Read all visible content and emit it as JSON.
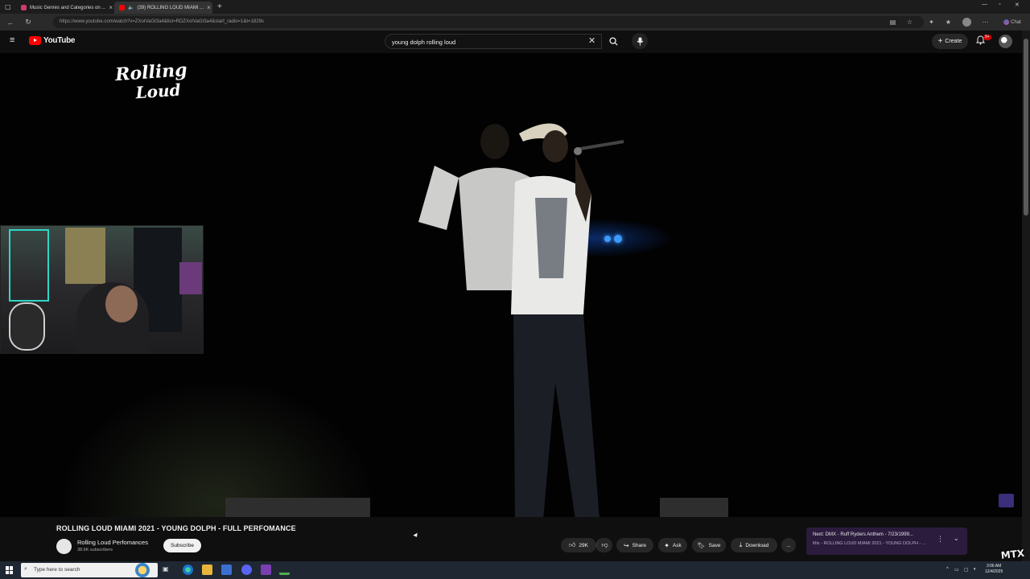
{
  "browser": {
    "tabs": [
      {
        "title": "Music Genres and Categories on ...",
        "active": false
      },
      {
        "title": "(39) ROLLING LOUD MIAMI ...",
        "active": true
      }
    ],
    "new_tab_label": "+",
    "url": "https://www.youtube.com/watch?v=ZXoIVaGt3a4&list=RDZXoIVaGt3a4&start_radio=1&t=1829s",
    "copilot_label": "Chat"
  },
  "youtube": {
    "logo_text": "YouTube",
    "search_query": "young dolph rolling loud",
    "create_label": "Create",
    "notifications_badge": "9+"
  },
  "video": {
    "overlay_logo_line1": "Rolling",
    "overlay_logo_line2": "Loud",
    "title": "ROLLING LOUD MIAMI 2021 - YOUNG DOLPH - FULL PERFOMANCE",
    "channel_name": "Rolling Loud Perfomances",
    "channel_subs": "38.6K subscribers",
    "subscribe_label": "Subscribe",
    "like_count": "29K",
    "share_label": "Share",
    "ask_label": "Ask",
    "save_label": "Save",
    "download_label": "Download",
    "more_label": "..."
  },
  "up_next": {
    "line1": "Next: DMX - Ruff Ryders Anthem - 7/23/1999...",
    "line2": "Mix - ROLLING LOUD MIAMI 2021 - YOUNG DOLPH - ..."
  },
  "taskbar": {
    "search_placeholder": "Type here to search",
    "time": "3:06 AM",
    "date": "12/4/2025"
  },
  "streamer_logo": "MTX"
}
